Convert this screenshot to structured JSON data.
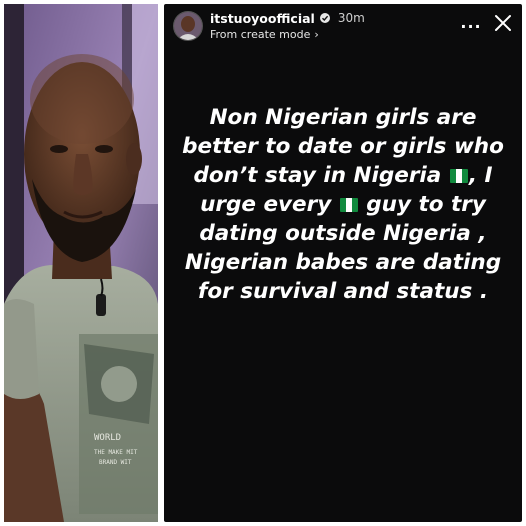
{
  "left_photo": {
    "shirt_print": [
      "WORLD",
      "THE MAKE MIT",
      "BRAND WIT"
    ]
  },
  "story": {
    "username": "itstuoyoofficial",
    "verified_icon": "verified-badge-icon",
    "time_ago": "30m",
    "source": "From create mode",
    "source_chevron": "›",
    "more_label": "...",
    "close_icon": "close-icon",
    "text_parts": [
      "Non Nigerian girls are better to date or girls who don’t stay in Nigeria",
      ", I urge every",
      "guy to try dating outside Nigeria , Nigerian babes are dating for survival and status ."
    ],
    "flag_icon": "nigeria-flag-icon",
    "colors": {
      "background": "#0b0b0c",
      "text": "#ffffff",
      "flag_green": "#118a3e"
    }
  }
}
